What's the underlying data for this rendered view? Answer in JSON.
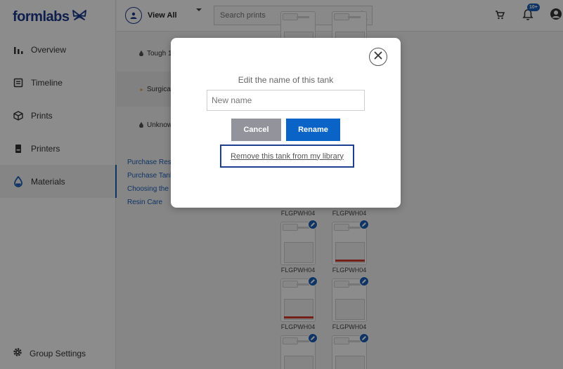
{
  "app": {
    "logo_text": "formlabs"
  },
  "sidebar": {
    "items": [
      {
        "label": "Overview",
        "icon": "bar-chart-icon"
      },
      {
        "label": "Timeline",
        "icon": "timeline-icon"
      },
      {
        "label": "Prints",
        "icon": "cube-icon"
      },
      {
        "label": "Printers",
        "icon": "printer-icon"
      },
      {
        "label": "Materials",
        "icon": "droplet-icon",
        "active": true
      }
    ],
    "group_settings": "Group Settings"
  },
  "topbar": {
    "view_label": "View All",
    "search_placeholder": "Search prints",
    "notification_badge": "10+"
  },
  "main": {
    "resins": [
      {
        "label": "Tough 1"
      },
      {
        "label": "Surgical"
      },
      {
        "label": "Unknow"
      }
    ],
    "links": [
      "Purchase Resi",
      "Purchase Tanl",
      "Choosing the",
      "Resin Care"
    ],
    "tank_labels": [
      "FLGPWH04",
      "FLGPWH04",
      "FLGPWH04",
      "FLGPWH04",
      "FLGPWH04",
      "FLGPWH04"
    ]
  },
  "modal": {
    "title": "Edit the name of this tank",
    "input_placeholder": "New name",
    "cancel_label": "Cancel",
    "rename_label": "Rename",
    "remove_label": "Remove this tank from my library"
  },
  "colors": {
    "brand": "#1c3a8c",
    "accent": "#0a64c8",
    "cancel": "#93939b",
    "stripe": "#d23b2e"
  }
}
